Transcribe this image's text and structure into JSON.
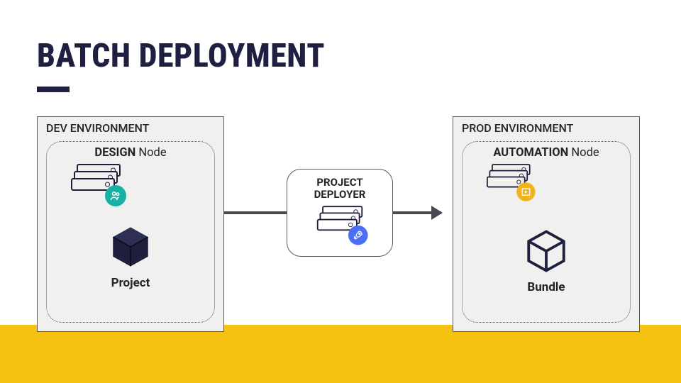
{
  "title": "BATCH DEPLOYMENT",
  "dev": {
    "env_label": "DEV ENVIRONMENT",
    "node_prefix": "DESIGN",
    "node_suffix": " Node",
    "object_label": "Project"
  },
  "prod": {
    "env_label": "PROD ENVIRONMENT",
    "node_prefix": "AUTOMATION",
    "node_suffix": " Node",
    "object_label": "Bundle"
  },
  "deployer": {
    "line1": "PROJECT",
    "line2": "DEPLOYER"
  },
  "colors": {
    "accent_yellow": "#f5c211",
    "ink": "#1f2041",
    "badge_teal": "#17b1a3",
    "badge_blue": "#4c6ef5",
    "badge_yellow": "#f2b31a"
  }
}
